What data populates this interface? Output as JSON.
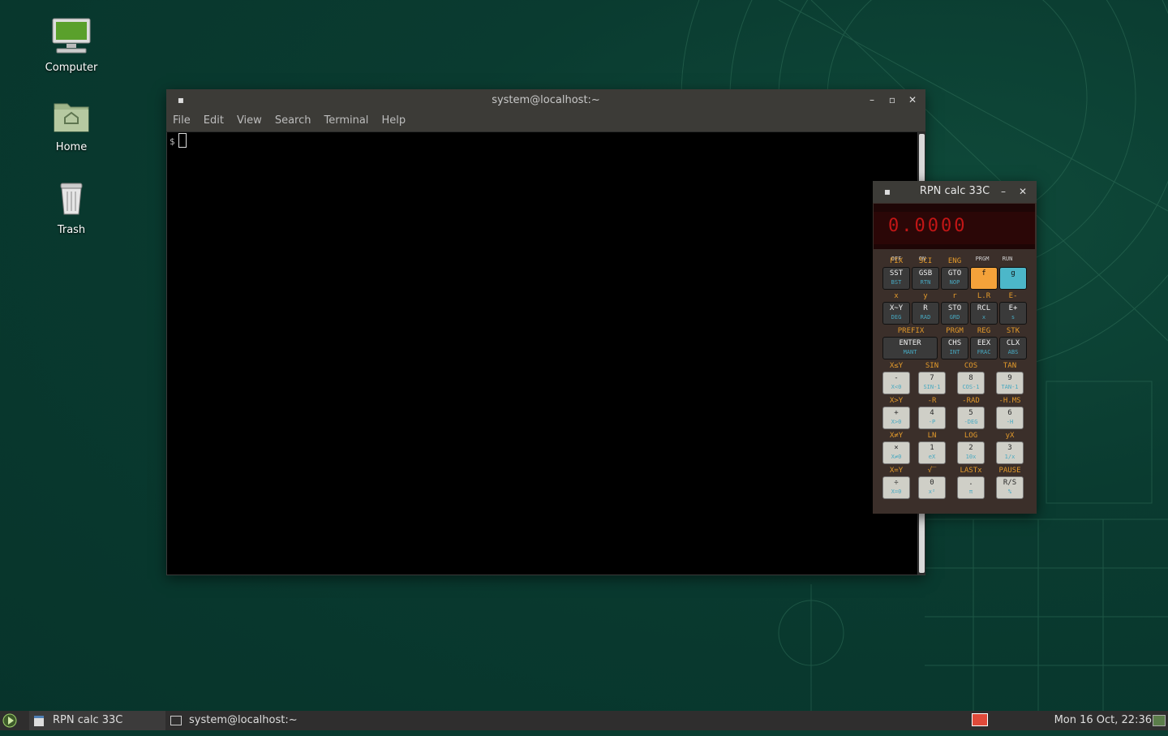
{
  "desktop": {
    "icons": [
      {
        "label": "Computer",
        "icon": "computer-icon"
      },
      {
        "label": "Home",
        "icon": "home-folder-icon"
      },
      {
        "label": "Trash",
        "icon": "trash-icon"
      }
    ]
  },
  "terminal": {
    "title": "system@localhost:~",
    "menu": [
      "File",
      "Edit",
      "View",
      "Search",
      "Terminal",
      "Help"
    ],
    "prompt": "$"
  },
  "calculator": {
    "title": "RPN calc 33C",
    "display": "0.0000",
    "switch_labels": {
      "off": "OFF",
      "on": "ON",
      "prgm": "PRGM",
      "run": "RUN"
    },
    "rows": [
      {
        "tags": [
          "FIX",
          "SCI",
          "ENG",
          "",
          ""
        ],
        "keys": [
          {
            "top": "SST",
            "bot": "BST",
            "style": "dark"
          },
          {
            "top": "GSB",
            "bot": "RTN",
            "style": "dark"
          },
          {
            "top": "GTO",
            "bot": "NOP",
            "style": "dark"
          },
          {
            "top": "f",
            "bot": "",
            "style": "f"
          },
          {
            "top": "g",
            "bot": "",
            "style": "g"
          }
        ]
      },
      {
        "tags": [
          "x",
          "y",
          "r",
          "L.R",
          "E-"
        ],
        "keys": [
          {
            "top": "X~Y",
            "bot": "DEG",
            "style": "dark"
          },
          {
            "top": "R",
            "bot": "RAD",
            "style": "dark"
          },
          {
            "top": "STO",
            "bot": "GRD",
            "style": "dark"
          },
          {
            "top": "RCL",
            "bot": "x",
            "style": "dark"
          },
          {
            "top": "E+",
            "bot": "s",
            "style": "dark"
          }
        ]
      },
      {
        "tags": [
          "PREFIX",
          "PRGM",
          "REG",
          "STK"
        ],
        "keys": [
          {
            "top": "ENTER",
            "bot": "MANT",
            "style": "dark",
            "wide": true
          },
          {
            "top": "CHS",
            "bot": "INT",
            "style": "dark"
          },
          {
            "top": "EEX",
            "bot": "FRAC",
            "style": "dark"
          },
          {
            "top": "CLX",
            "bot": "ABS",
            "style": "dark"
          }
        ]
      },
      {
        "tags": [
          "X≤Y",
          "SIN",
          "COS",
          "TAN"
        ],
        "keys": [
          {
            "top": "-",
            "bot": "X<0",
            "style": "light"
          },
          {
            "top": "7",
            "bot": "SIN-1",
            "style": "light"
          },
          {
            "top": "8",
            "bot": "COS-1",
            "style": "light"
          },
          {
            "top": "9",
            "bot": "TAN-1",
            "style": "light"
          }
        ]
      },
      {
        "tags": [
          "X>Y",
          "-R",
          "-RAD",
          "-H.MS"
        ],
        "keys": [
          {
            "top": "+",
            "bot": "X>0",
            "style": "light"
          },
          {
            "top": "4",
            "bot": "-P",
            "style": "light"
          },
          {
            "top": "5",
            "bot": "-DEG",
            "style": "light"
          },
          {
            "top": "6",
            "bot": "-H",
            "style": "light"
          }
        ]
      },
      {
        "tags": [
          "X≠Y",
          "LN",
          "LOG",
          "yX"
        ],
        "keys": [
          {
            "top": "×",
            "bot": "X≠0",
            "style": "light"
          },
          {
            "top": "1",
            "bot": "eX",
            "style": "light"
          },
          {
            "top": "2",
            "bot": "10x",
            "style": "light"
          },
          {
            "top": "3",
            "bot": "1/x",
            "style": "light"
          }
        ]
      },
      {
        "tags": [
          "X=Y",
          "√‾",
          "LASTx",
          "PAUSE"
        ],
        "keys": [
          {
            "top": "÷",
            "bot": "X=0",
            "style": "light"
          },
          {
            "top": "0",
            "bot": "x²",
            "style": "light"
          },
          {
            "top": ".",
            "bot": "π",
            "style": "light"
          },
          {
            "top": "R/S",
            "bot": "%",
            "style": "light"
          }
        ]
      }
    ]
  },
  "taskbar": {
    "tasks": [
      "RPN calc 33C",
      "system@localhost:~"
    ],
    "clock": "Mon 16 Oct, 22:36"
  }
}
